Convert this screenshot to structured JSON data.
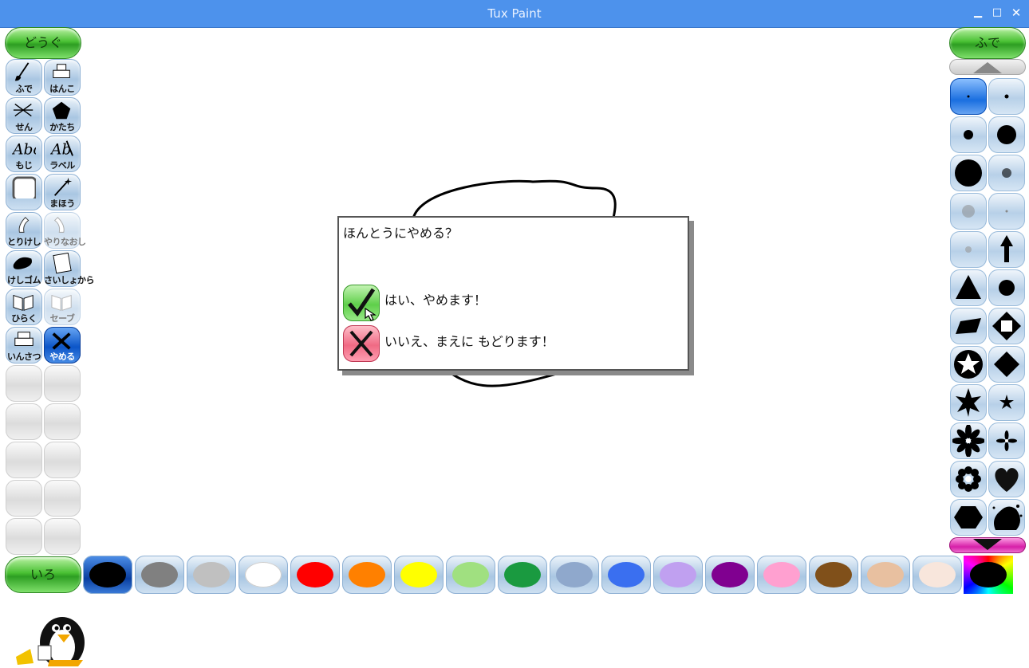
{
  "window": {
    "title": "Tux Paint"
  },
  "toolbox": {
    "header": "どうぐ",
    "tools": [
      {
        "label": "ふで",
        "icon": "brush-icon",
        "state": "normal"
      },
      {
        "label": "はんこ",
        "icon": "stamp-icon",
        "state": "normal"
      },
      {
        "label": "せん",
        "icon": "lines-icon",
        "state": "normal"
      },
      {
        "label": "かたち",
        "icon": "pentagon-icon",
        "state": "normal"
      },
      {
        "label": "もじ",
        "icon": "text-icon",
        "state": "normal"
      },
      {
        "label": "ラベル",
        "icon": "label-icon",
        "state": "normal"
      },
      {
        "label": "",
        "icon": "fill-square-icon",
        "state": "normal"
      },
      {
        "label": "まほう",
        "icon": "magic-wand-icon",
        "state": "normal"
      },
      {
        "label": "とりけし",
        "icon": "undo-icon",
        "state": "normal"
      },
      {
        "label": "やりなおし",
        "icon": "redo-icon",
        "state": "disabled"
      },
      {
        "label": "けしゴム",
        "icon": "eraser-icon",
        "state": "normal"
      },
      {
        "label": "さいしょから",
        "icon": "new-page-icon",
        "state": "normal"
      },
      {
        "label": "ひらく",
        "icon": "open-book-icon",
        "state": "normal"
      },
      {
        "label": "セーブ",
        "icon": "save-icon",
        "state": "disabled"
      },
      {
        "label": "いんさつ",
        "icon": "print-icon",
        "state": "normal"
      },
      {
        "label": "やめる",
        "icon": "quit-icon",
        "state": "active"
      }
    ]
  },
  "brushes": {
    "header": "ふで",
    "scroll_up": "up-arrow-icon",
    "scroll_down": "down-arrow-icon",
    "items": [
      "tiny-dot",
      "small-dot",
      "medium-dot",
      "large-dot",
      "big-dot",
      "blur-dot",
      "soft-dot",
      "faint-dot",
      "faint-small-dot",
      "arrow-up",
      "triangle",
      "circle",
      "parallelogram",
      "diamond-outline",
      "star-outline",
      "diamond",
      "star-six",
      "star-small",
      "flower",
      "flower-small",
      "gear-flower",
      "heart",
      "hexagon",
      "splatter"
    ]
  },
  "colors": {
    "header": "いろ",
    "swatches": [
      "#000000",
      "#808080",
      "#c0c0c0",
      "#ffffff",
      "#ff0000",
      "#ff8000",
      "#ffff00",
      "#a0e080",
      "#1a9a40",
      "#8fa8cc",
      "#3a6ff0",
      "#c0a0f0",
      "#800090",
      "#ffa0d0",
      "#80501a",
      "#e8c0a0",
      "#f8e6dc"
    ],
    "selected_index": 0,
    "picker": "rainbow-picker-icon"
  },
  "dialog": {
    "question": "ほんとうにやめる？",
    "yes_label": "はい、やめます！",
    "no_label": "いいえ、まえに もどります！"
  }
}
